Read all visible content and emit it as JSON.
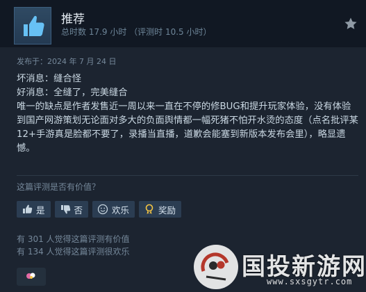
{
  "header": {
    "verdict": "推荐",
    "hours": "总时数 17.9 小时 （评测时 10.5 小时）"
  },
  "posted": "发布于：2024 年 7 月 24 日",
  "review": {
    "lines": [
      "坏消息：缝合怪",
      "好消息：全缝了，完美缝合",
      "唯一的缺点是作者发售近一周以来一直在不停的修BUG和提升玩家体验，没有体验到国产网游策划无论面对多大的负面舆情都一幅死猪不怕开水烫的态度（点名批评某12+手游真是脸都不要了，录播当直播，道歉会能塞到新版本发布会里），略显遗憾。"
    ]
  },
  "helpful": {
    "question": "这篇评测是否有价值？",
    "buttons": {
      "yes": "是",
      "no": "否",
      "funny": "欢乐",
      "award": "奖励"
    },
    "helpful_count": "有 301 人觉得这篇评测有价值",
    "funny_count": "有 134 人觉得这篇评测很欢乐"
  },
  "watermark": {
    "name": "国投新游网",
    "url": "www.sxsgytr.com"
  },
  "colors": {
    "header_bg": "#111823",
    "page_bg": "#1c2430",
    "button_bg": "#2b3d52",
    "thumb_blue": "#66c0f4"
  }
}
